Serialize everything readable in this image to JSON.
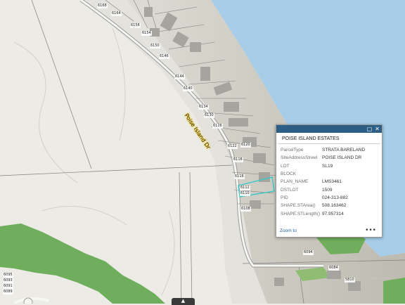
{
  "map": {
    "road_name": "Poise Island Dr",
    "lot_labels_road": [
      "6168",
      "6164",
      "6158",
      "6154",
      "6150",
      "6146",
      "6144",
      "6140",
      "6134",
      "6130",
      "6126",
      "6122",
      "6120",
      "6118",
      "6116",
      "6112",
      "6110",
      "6108"
    ],
    "lot_labels_bottom": [
      "6094",
      "6084",
      "5810",
      "6095",
      "6093",
      "6091",
      "6089"
    ],
    "colors": {
      "water": "#a7cde8",
      "land": "#ecebe6",
      "park": "#6fae5c",
      "selection": "#35c9c9",
      "popup_header": "#2c5e86"
    }
  },
  "popup": {
    "title": "POISE ISLAND ESTATES",
    "maximize_icon": "maximize-icon",
    "close_icon": "close-icon",
    "fields": [
      {
        "key": "ParcelType",
        "value": "STRATA BARELAND"
      },
      {
        "key": "SiteAddressStreet",
        "value": "POISE ISLAND DR"
      },
      {
        "key": "LOT",
        "value": "SL19"
      },
      {
        "key": "BLOCK",
        "value": ""
      },
      {
        "key": "PLAN_NAME",
        "value": "LMS3461"
      },
      {
        "key": "DSTLOT",
        "value": "1509"
      },
      {
        "key": "PID",
        "value": "024-313-882"
      },
      {
        "key": "SHAPE.STArea()",
        "value": "508.163462"
      },
      {
        "key": "SHAPE.STLength()",
        "value": "97.957314"
      }
    ],
    "zoom_label": "Zoom to",
    "more_label": "•••"
  },
  "bottom_handle": "▲"
}
